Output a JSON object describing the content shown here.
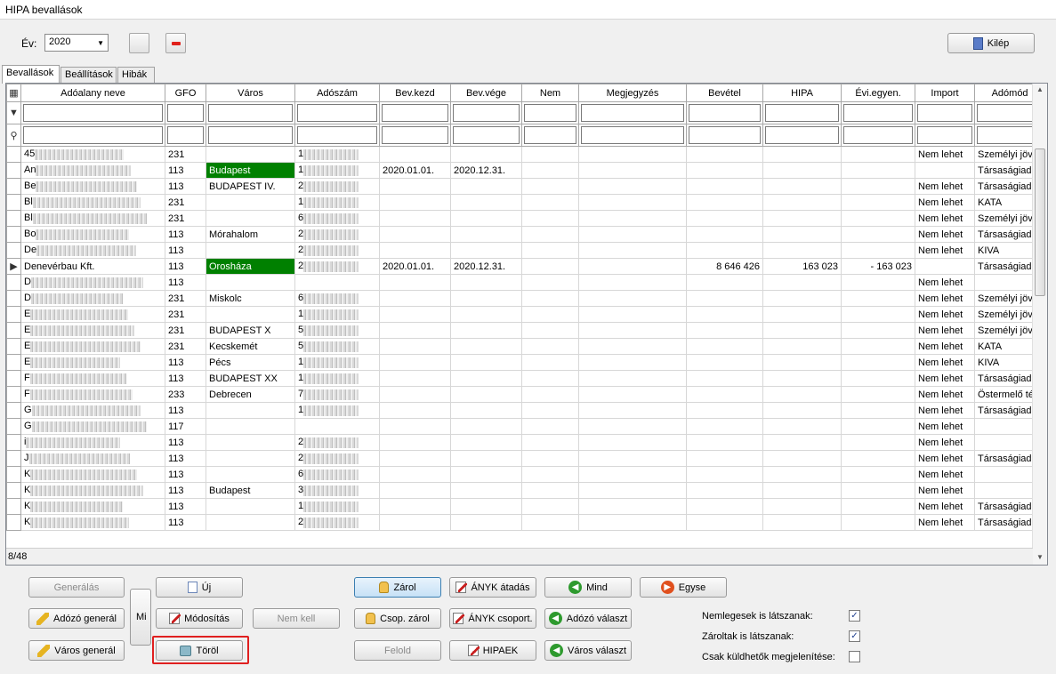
{
  "window": {
    "title": "HIPA bevallások"
  },
  "topbar": {
    "ev_label": "Év:",
    "year": "2020",
    "exit_label": "Kilép"
  },
  "tabs": [
    "Bevallások",
    "Beállítások",
    "Hibák"
  ],
  "table": {
    "columns": [
      "Adóalany neve",
      "GFO",
      "Város",
      "Adószám",
      "Bev.kezd",
      "Bev.vége",
      "Nem",
      "Megjegyzés",
      "Bevétel",
      "HIPA",
      "Évi.egyen.",
      "Import",
      "Adómód"
    ],
    "rows": [
      {
        "name": "45",
        "gfo": "231",
        "city": "",
        "adoszam": "1",
        "kezd": "",
        "vege": "",
        "bevetel": "",
        "hipa": "",
        "evi": "",
        "import": "Nem lehet",
        "adomod": "Személyi jöve"
      },
      {
        "name": "An",
        "gfo": "113",
        "city": "Budapest",
        "adoszam": "1",
        "kezd": "2020.01.01.",
        "vege": "2020.12.31.",
        "bevetel": "",
        "hipa": "",
        "evi": "",
        "import": "",
        "adomod": "Társaságiadó"
      },
      {
        "name": "Be",
        "gfo": "113",
        "city": "BUDAPEST IV.",
        "adoszam": "2",
        "kezd": "",
        "vege": "",
        "bevetel": "",
        "hipa": "",
        "evi": "",
        "import": "Nem lehet",
        "adomod": "Társaságiadó"
      },
      {
        "name": "Bl",
        "gfo": "231",
        "city": "",
        "adoszam": "1",
        "kezd": "",
        "vege": "",
        "bevetel": "",
        "hipa": "",
        "evi": "",
        "import": "Nem lehet",
        "adomod": "KATA"
      },
      {
        "name": "Bl",
        "gfo": "231",
        "city": "",
        "adoszam": "6",
        "kezd": "",
        "vege": "",
        "bevetel": "",
        "hipa": "",
        "evi": "",
        "import": "Nem lehet",
        "adomod": "Személyi jöve"
      },
      {
        "name": "Bo",
        "gfo": "113",
        "city": "Mórahalom",
        "adoszam": "2",
        "kezd": "",
        "vege": "",
        "bevetel": "",
        "hipa": "",
        "evi": "",
        "import": "Nem lehet",
        "adomod": "Társaságiadó"
      },
      {
        "name": "De",
        "gfo": "113",
        "city": "",
        "adoszam": "2",
        "kezd": "",
        "vege": "",
        "bevetel": "",
        "hipa": "",
        "evi": "",
        "import": "Nem lehet",
        "adomod": "KIVA"
      },
      {
        "name": "Denevérbau Kft.",
        "gfo": "113",
        "city": "Orosháza",
        "adoszam": "2",
        "kezd": "2020.01.01.",
        "vege": "2020.12.31.",
        "bevetel": "8 646 426",
        "hipa": "163 023",
        "evi": "- 163 023",
        "import": "",
        "adomod": "Társaságiadó"
      },
      {
        "name": "D",
        "gfo": "113",
        "city": "",
        "adoszam": "",
        "kezd": "",
        "vege": "",
        "bevetel": "",
        "hipa": "",
        "evi": "",
        "import": "Nem lehet",
        "adomod": ""
      },
      {
        "name": "D",
        "gfo": "231",
        "city": "Miskolc",
        "adoszam": "6",
        "kezd": "",
        "vege": "",
        "bevetel": "",
        "hipa": "",
        "evi": "",
        "import": "Nem lehet",
        "adomod": "Személyi jöve"
      },
      {
        "name": "E",
        "gfo": "231",
        "city": "",
        "adoszam": "1",
        "kezd": "",
        "vege": "",
        "bevetel": "",
        "hipa": "",
        "evi": "",
        "import": "Nem lehet",
        "adomod": "Személyi jöve"
      },
      {
        "name": "E",
        "gfo": "231",
        "city": "BUDAPEST X",
        "adoszam": "5",
        "kezd": "",
        "vege": "",
        "bevetel": "",
        "hipa": "",
        "evi": "",
        "import": "Nem lehet",
        "adomod": "Személyi jöve"
      },
      {
        "name": "E",
        "gfo": "231",
        "city": "Kecskemét",
        "adoszam": "5",
        "kezd": "",
        "vege": "",
        "bevetel": "",
        "hipa": "",
        "evi": "",
        "import": "Nem lehet",
        "adomod": "KATA"
      },
      {
        "name": "E",
        "gfo": "113",
        "city": "Pécs",
        "adoszam": "1",
        "kezd": "",
        "vege": "",
        "bevetel": "",
        "hipa": "",
        "evi": "",
        "import": "Nem lehet",
        "adomod": "KIVA"
      },
      {
        "name": "F",
        "gfo": "113",
        "city": "BUDAPEST XX",
        "adoszam": "1",
        "kezd": "",
        "vege": "",
        "bevetel": "",
        "hipa": "",
        "evi": "",
        "import": "Nem lehet",
        "adomod": "Társaságiadó"
      },
      {
        "name": "F",
        "gfo": "233",
        "city": "Debrecen",
        "adoszam": "7",
        "kezd": "",
        "vege": "",
        "bevetel": "",
        "hipa": "",
        "evi": "",
        "import": "Nem lehet",
        "adomod": "Östermelő téte"
      },
      {
        "name": "G",
        "gfo": "113",
        "city": "",
        "adoszam": "1",
        "kezd": "",
        "vege": "",
        "bevetel": "",
        "hipa": "",
        "evi": "",
        "import": "Nem lehet",
        "adomod": "Társaságiadó"
      },
      {
        "name": "G",
        "gfo": "117",
        "city": "",
        "adoszam": "",
        "kezd": "",
        "vege": "",
        "bevetel": "",
        "hipa": "",
        "evi": "",
        "import": "Nem lehet",
        "adomod": ""
      },
      {
        "name": "i",
        "gfo": "113",
        "city": "",
        "adoszam": "2",
        "kezd": "",
        "vege": "",
        "bevetel": "",
        "hipa": "",
        "evi": "",
        "import": "Nem lehet",
        "adomod": ""
      },
      {
        "name": "J",
        "gfo": "113",
        "city": "",
        "adoszam": "2",
        "kezd": "",
        "vege": "",
        "bevetel": "",
        "hipa": "",
        "evi": "",
        "import": "Nem lehet",
        "adomod": "Társaságiadó"
      },
      {
        "name": "K",
        "gfo": "113",
        "city": "",
        "adoszam": "6",
        "kezd": "",
        "vege": "",
        "bevetel": "",
        "hipa": "",
        "evi": "",
        "import": "Nem lehet",
        "adomod": ""
      },
      {
        "name": "K",
        "gfo": "113",
        "city": "Budapest",
        "adoszam": "3",
        "kezd": "",
        "vege": "",
        "bevetel": "",
        "hipa": "",
        "evi": "",
        "import": "Nem lehet",
        "adomod": ""
      },
      {
        "name": "K",
        "gfo": "113",
        "city": "",
        "adoszam": "1",
        "kezd": "",
        "vege": "",
        "bevetel": "",
        "hipa": "",
        "evi": "",
        "import": "Nem lehet",
        "adomod": "Társaságiadó"
      },
      {
        "name": "K",
        "gfo": "113",
        "city": "",
        "adoszam": "2",
        "kezd": "",
        "vege": "",
        "bevetel": "",
        "hipa": "",
        "evi": "",
        "import": "Nem lehet",
        "adomod": "Társaságiadó"
      }
    ],
    "record_counter": "8/48"
  },
  "buttons": {
    "generalas": "Generálás",
    "adozo_general": "Adózó generál",
    "varos_general": "Város generál",
    "mi": "Mi",
    "uj": "Új",
    "modositas": "Módosítás",
    "torol": "Töröl",
    "nem_kell": "Nem kell",
    "zarol": "Zárol",
    "csop_zarol": "Csop. zárol",
    "felold": "Felold",
    "anyk_atadas": "ÁNYK átadás",
    "anyk_csoport": "ÁNYK csoport.",
    "hipaek": "HIPAEK",
    "mind": "Mind",
    "adozo_valaszt": "Adózó választ",
    "varos_valaszt": "Város választ",
    "egyse": "Egyse"
  },
  "options": {
    "nemlegesek": "Nemlegesek is látszanak:",
    "zaroltak": "Zároltak is látszanak:",
    "csak_kuldhetok": "Csak küldhetők megjelenítése:",
    "nemlegesek_checked": true,
    "zaroltak_checked": true,
    "csak_kuldhetok_checked": false
  }
}
